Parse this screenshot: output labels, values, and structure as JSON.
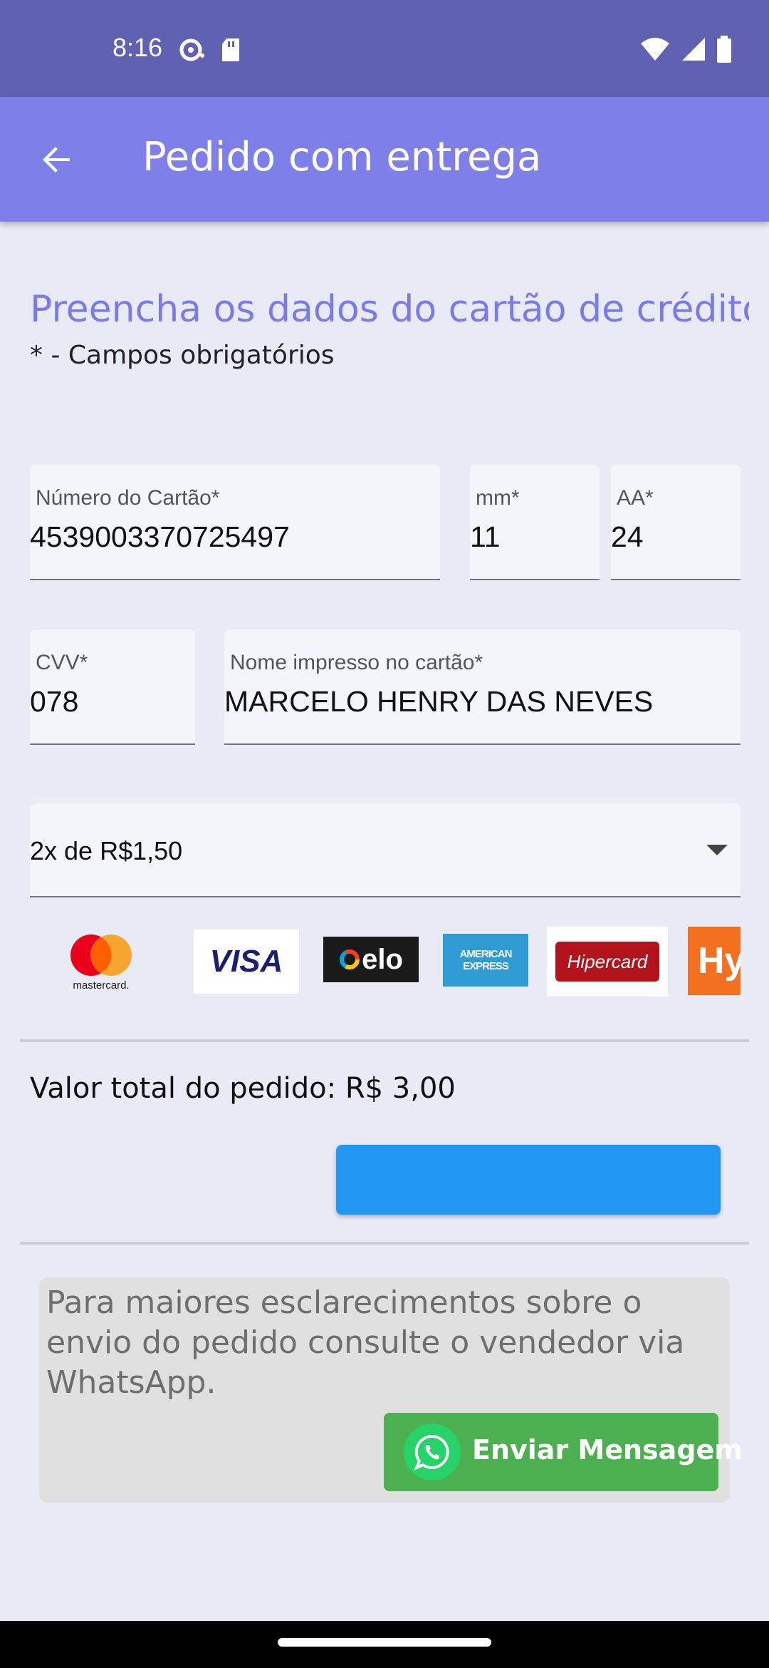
{
  "status_bar": {
    "time": "8:16",
    "left_icons": [
      "data-saver-icon",
      "sd-card-icon"
    ],
    "right_icons": [
      "wifi-icon",
      "cell-signal-icon",
      "battery-icon"
    ]
  },
  "app_bar": {
    "title": "Pedido com entrega",
    "back_icon": "arrow-back-icon"
  },
  "form": {
    "heading": "Preencha os dados do cartão de crédito",
    "required_note": "* - Campos obrigatórios",
    "card_number": {
      "label": "Número do Cartão*",
      "value": "4539003370725497"
    },
    "month": {
      "label": "mm*",
      "value": "11"
    },
    "year": {
      "label": "AA*",
      "value": "24"
    },
    "cvv": {
      "label": "CVV*",
      "value": "078"
    },
    "name": {
      "label": "Nome impresso no cartão*",
      "value": "MARCELO HENRY DAS NEVES"
    },
    "installments": {
      "value": "2x de R$1,50"
    }
  },
  "brands": {
    "mastercard": "mastercard.",
    "visa": "VISA",
    "elo": "elo",
    "amex_line1": "AMERICAN",
    "amex_line2": "EXPRESS",
    "hipercard": "Hipercard",
    "hiper": "Hy"
  },
  "order": {
    "total": "Valor total do pedido: R$ 3,00"
  },
  "info": {
    "text": "Para maiores esclarecimentos sobre o envio do pedido consulte o vendedor via WhatsApp.",
    "whatsapp_button": "Enviar Mensagem"
  },
  "colors": {
    "status_bar": "#6161b4",
    "app_bar": "#7f7fea",
    "heading": "#7b7be6",
    "primary_button": "#2196f3",
    "whatsapp_button": "#4caf50"
  }
}
